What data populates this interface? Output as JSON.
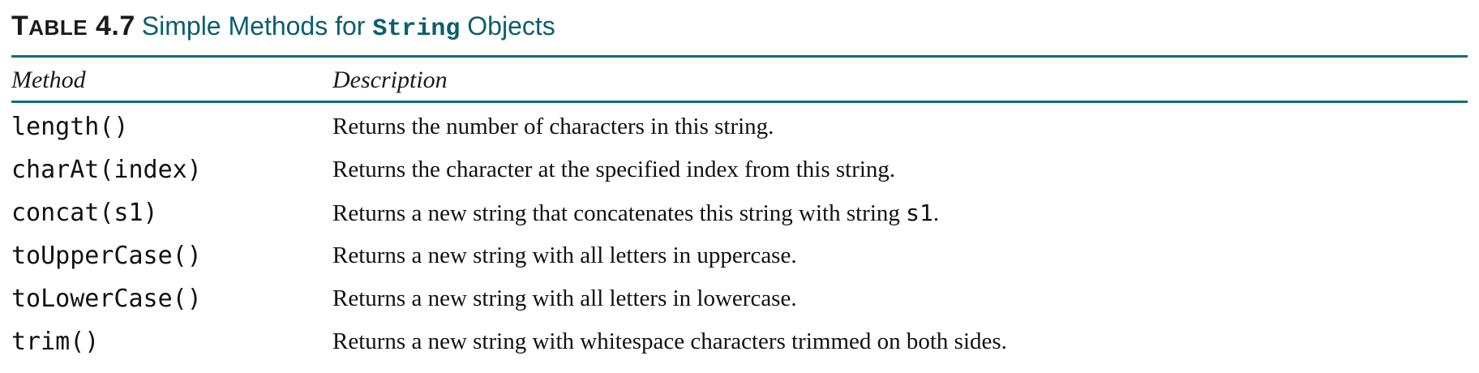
{
  "caption": {
    "label_first": "T",
    "label_rest": "ABLE",
    "label_number": "4.7",
    "title_before": "Simple Methods for",
    "title_code": "String",
    "title_after": "Objects"
  },
  "table": {
    "headers": {
      "method": "Method",
      "description": "Description"
    },
    "rows": [
      {
        "method": "length()",
        "description": "Returns the number of characters in this string.",
        "desc_code": "",
        "desc_after": ""
      },
      {
        "method": "charAt(index)",
        "description": "Returns the character at the specified index from this string.",
        "desc_code": "",
        "desc_after": ""
      },
      {
        "method": "concat(s1)",
        "description": "Returns a new string that concatenates this string with string ",
        "desc_code": "s1",
        "desc_after": "."
      },
      {
        "method": "toUpperCase()",
        "description": "Returns a new string with all letters in uppercase.",
        "desc_code": "",
        "desc_after": ""
      },
      {
        "method": "toLowerCase()",
        "description": "Returns a new string with all letters in lowercase.",
        "desc_code": "",
        "desc_after": ""
      },
      {
        "method": "trim()",
        "description": "Returns a new string with whitespace characters trimmed on both sides.",
        "desc_code": "",
        "desc_after": ""
      }
    ]
  },
  "colors": {
    "accent": "#0f6f7a",
    "title_text": "#0a5e6e",
    "body_text": "#111111"
  }
}
